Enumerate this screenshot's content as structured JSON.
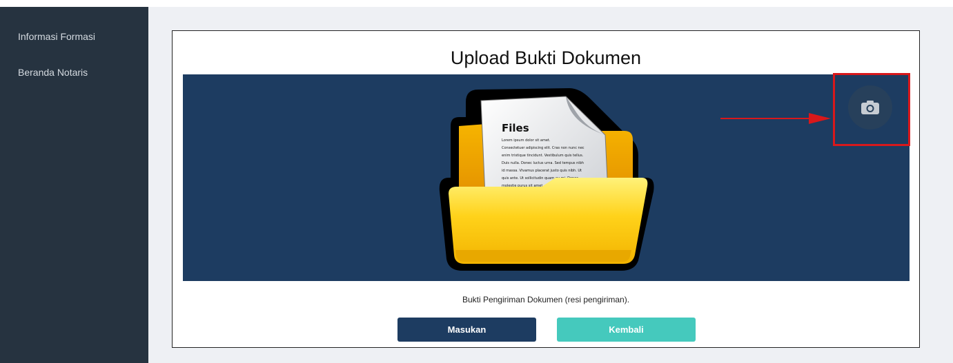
{
  "sidebar": {
    "items": [
      {
        "label": "Informasi Formasi"
      },
      {
        "label": "Beranda Notaris"
      }
    ]
  },
  "panel": {
    "title": "Upload Bukti Dokumen",
    "caption": "Bukti Pengiriman Dokumen (resi pengiriman).",
    "buttons": {
      "submit_label": "Masukan",
      "back_label": "Kembali"
    }
  },
  "illustration": {
    "heading": "Files",
    "body_lines": [
      "Lorem ipsum dolor sit amet.",
      "Consectetuer adipiscing elit. Cras non nunc nec",
      "enim tristique tincidunt. Vestibulum quis tellus.",
      "Duis nulla. Donec luctus urna. Sed tempus nibh",
      "id massa. Vivamus placerat justo quis nibh. Ut",
      "quis ante. Ut sollicitudin quam eu mi. Donec",
      "molestie purus sit amet"
    ]
  },
  "icons": {
    "camera": "camera-icon",
    "annotation_arrow": "red-arrow"
  },
  "colors": {
    "sidebar_bg": "#263340",
    "preview_bg": "#1d3c61",
    "primary_button": "#1d3c61",
    "secondary_button": "#45c9bd",
    "highlight": "#d9181b"
  }
}
